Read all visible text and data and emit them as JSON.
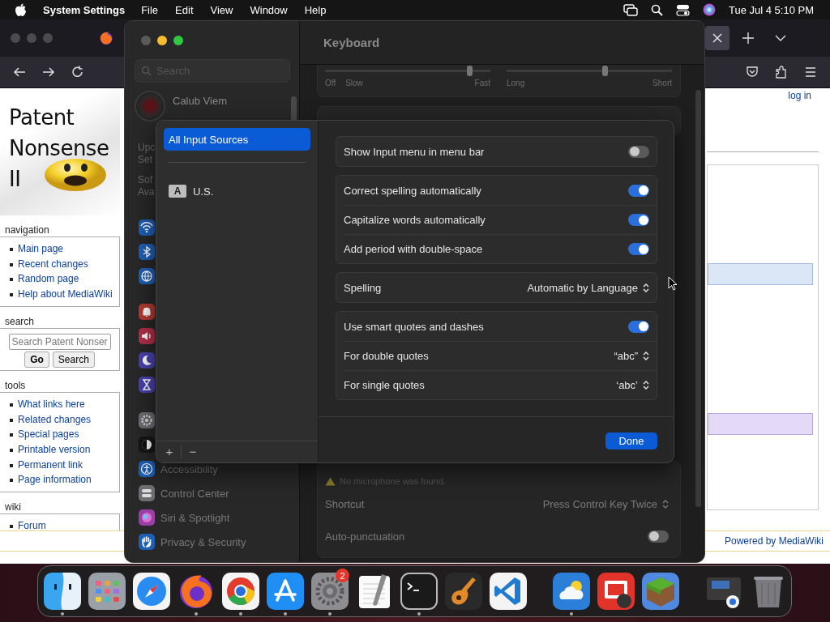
{
  "menu_bar": {
    "app_name": "System Settings",
    "menus": [
      "File",
      "Edit",
      "View",
      "Window",
      "Help"
    ],
    "clock": "Tue Jul 4  5:10 PM"
  },
  "browser": {
    "wiki": {
      "logo_lines": [
        "Patent",
        "Nonsense",
        "II"
      ],
      "portlets": [
        {
          "kind": "links",
          "title": "navigation",
          "links": [
            "Main page",
            "Recent changes",
            "Random page",
            "Help about MediaWiki"
          ]
        },
        {
          "kind": "search",
          "title": "search",
          "placeholder": "Search Patent Nonser",
          "buttons": [
            "Go",
            "Search"
          ]
        },
        {
          "kind": "links",
          "title": "tools",
          "links": [
            "What links here",
            "Related changes",
            "Special pages",
            "Printable version",
            "Permanent link",
            "Page information"
          ]
        },
        {
          "kind": "links",
          "title": "wiki",
          "links": [
            "Forum"
          ]
        }
      ],
      "login": "log in",
      "footer": "Powered by MediaWiki"
    }
  },
  "settings": {
    "title": "Keyboard",
    "search_placeholder": "Search",
    "account": {
      "name": "Calub Viem"
    },
    "notice_lines": [
      "Upc",
      "Set",
      "Sof",
      "Ava"
    ],
    "sidebar": {
      "groups": [
        [
          {
            "kind": "wifi",
            "color": "#1d5fb5"
          },
          {
            "kind": "bluetooth",
            "color": "#1d5fb5"
          },
          {
            "kind": "network",
            "color": "#1d5fb5"
          }
        ],
        [
          {
            "kind": "notifications",
            "color": "#b33a31"
          },
          {
            "kind": "sound",
            "color": "#b32f4b"
          },
          {
            "kind": "focus",
            "color": "#4a41ad"
          },
          {
            "kind": "screen_time",
            "color": "#4a41ad"
          }
        ],
        [
          {
            "kind": "general",
            "color": "#6e6e72"
          },
          {
            "kind": "appearance",
            "color": "#161616"
          },
          {
            "kind": "accessibility",
            "color": "#1d5fb5",
            "label": "Accessibility"
          },
          {
            "kind": "control_center",
            "color": "#6e6e72",
            "label": "Control Center"
          },
          {
            "kind": "siri",
            "color": "#9b3fa6",
            "label": "Siri & Spotlight"
          },
          {
            "kind": "privacy",
            "color": "#1d5fb5",
            "label": "Privacy & Security"
          }
        ]
      ]
    },
    "sliders": [
      {
        "left_labels": [
          "Off",
          "Slow"
        ],
        "right_label": "Fast",
        "level": 0.89
      },
      {
        "left_labels": [
          "Long"
        ],
        "right_label": "Short",
        "level": 0.6
      }
    ],
    "warning": "No microphone was found.",
    "bottom_rows": [
      {
        "kind": "popup",
        "label": "Shortcut",
        "value": "Press Control Key Twice"
      },
      {
        "kind": "toggle",
        "label": "Auto-punctuation",
        "on": false
      }
    ]
  },
  "sheet": {
    "sources": [
      {
        "label": "All Input Sources",
        "selected": true
      },
      {
        "label": "U.S.",
        "badge": "A",
        "selected": false
      }
    ],
    "toolbar": [
      "+",
      "−"
    ],
    "groups": [
      [
        {
          "kind": "toggle",
          "label": "Show Input menu in menu bar",
          "on": false
        }
      ],
      [
        {
          "kind": "toggle",
          "label": "Correct spelling automatically",
          "on": true
        },
        {
          "kind": "toggle",
          "label": "Capitalize words automatically",
          "on": true
        },
        {
          "kind": "toggle",
          "label": "Add period with double-space",
          "on": true
        }
      ],
      [
        {
          "kind": "popup",
          "label": "Spelling",
          "value": "Automatic by Language"
        }
      ],
      [
        {
          "kind": "toggle",
          "label": "Use smart quotes and dashes",
          "on": true
        },
        {
          "kind": "popup",
          "label": "For double quotes",
          "value": "“abc”"
        },
        {
          "kind": "popup",
          "label": "For single quotes",
          "value": "‘abc’"
        }
      ]
    ],
    "done": "Done"
  },
  "dock": {
    "items": [
      {
        "kind": "finder",
        "running": true
      },
      {
        "kind": "launchpad",
        "running": false
      },
      {
        "kind": "safari",
        "running": false
      },
      {
        "kind": "firefox",
        "running": true
      },
      {
        "kind": "chrome",
        "running": true
      },
      {
        "kind": "appstore",
        "running": true
      },
      {
        "kind": "settings",
        "running": true,
        "badge": "2"
      },
      {
        "kind": "textedit",
        "running": false
      },
      {
        "kind": "terminal",
        "running": true
      },
      {
        "kind": "garageband",
        "running": false
      },
      {
        "kind": "vscode",
        "running": false
      },
      {
        "kind": "divider"
      },
      {
        "kind": "weather",
        "running": true
      },
      {
        "kind": "photobooth",
        "running": false
      },
      {
        "kind": "minecraft",
        "running": false
      },
      {
        "kind": "divider"
      },
      {
        "kind": "stack",
        "running": false
      },
      {
        "kind": "trash",
        "running": false
      }
    ]
  }
}
